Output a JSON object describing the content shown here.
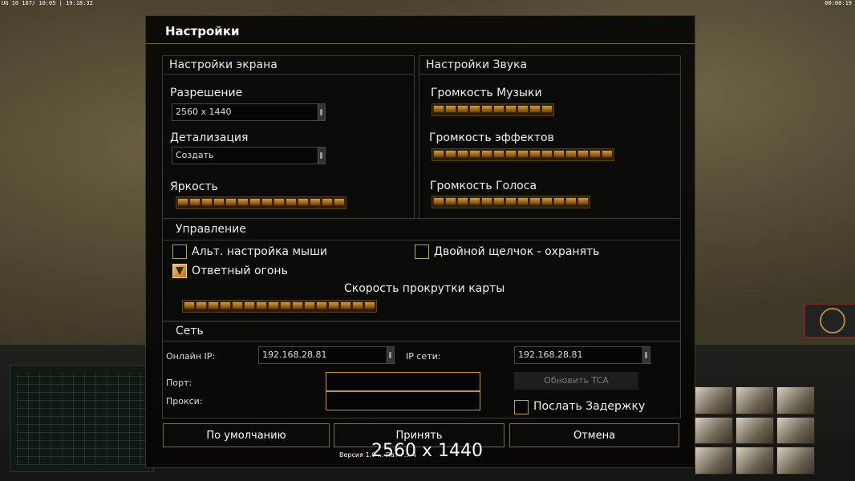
{
  "hud": {
    "top_left": "UG 10 167/ 10:05 | 19:18:32",
    "top_right": "00:00:19"
  },
  "dialog": {
    "title": "Настройки"
  },
  "screen": {
    "header": "Настройки экрана",
    "resolution_label": "Разрешение",
    "resolution_value": "2560 x 1440",
    "detail_label": "Детализация",
    "detail_value": "Создать",
    "brightness_label": "Яркость",
    "brightness_level": 14
  },
  "sound": {
    "header": "Настройки Звука",
    "music_label": "Громкость Музыки",
    "music_level": 10,
    "effects_label": "Громкость эффектов",
    "effects_level": 15,
    "voice_label": "Громкость Голоса",
    "voice_level": 13
  },
  "control": {
    "header": "Управление",
    "alt_mouse_label": "Альт. настройка мыши",
    "alt_mouse_checked": false,
    "double_click_label": "Двойной щелчок - охранять",
    "double_click_checked": false,
    "return_fire_label": "Ответный огонь",
    "return_fire_checked": true,
    "scroll_speed_label": "Скорость прокрутки карты",
    "scroll_speed_level": 16
  },
  "network": {
    "header": "Сеть",
    "online_ip_label": "Онлайн IP:",
    "online_ip_value": "192.168.28.81",
    "lan_ip_label": "IP сети:",
    "lan_ip_value": "192.168.28.81",
    "port_label": "Порт:",
    "port_value": "",
    "proxy_label": "Прокси:",
    "proxy_value": "",
    "update_tca_label": "Обновить TCA",
    "send_delay_label": "Послать Задержку",
    "send_delay_checked": false
  },
  "buttons": {
    "defaults": "По умолчанию",
    "accept": "Принять",
    "cancel": "Отмена"
  },
  "version_text": "Версия 1.0 ... Патч ... 4",
  "resolution_overlay": "2560 x 1440",
  "colors": {
    "accent": "#c8952a",
    "slider": "#d49a3a"
  }
}
